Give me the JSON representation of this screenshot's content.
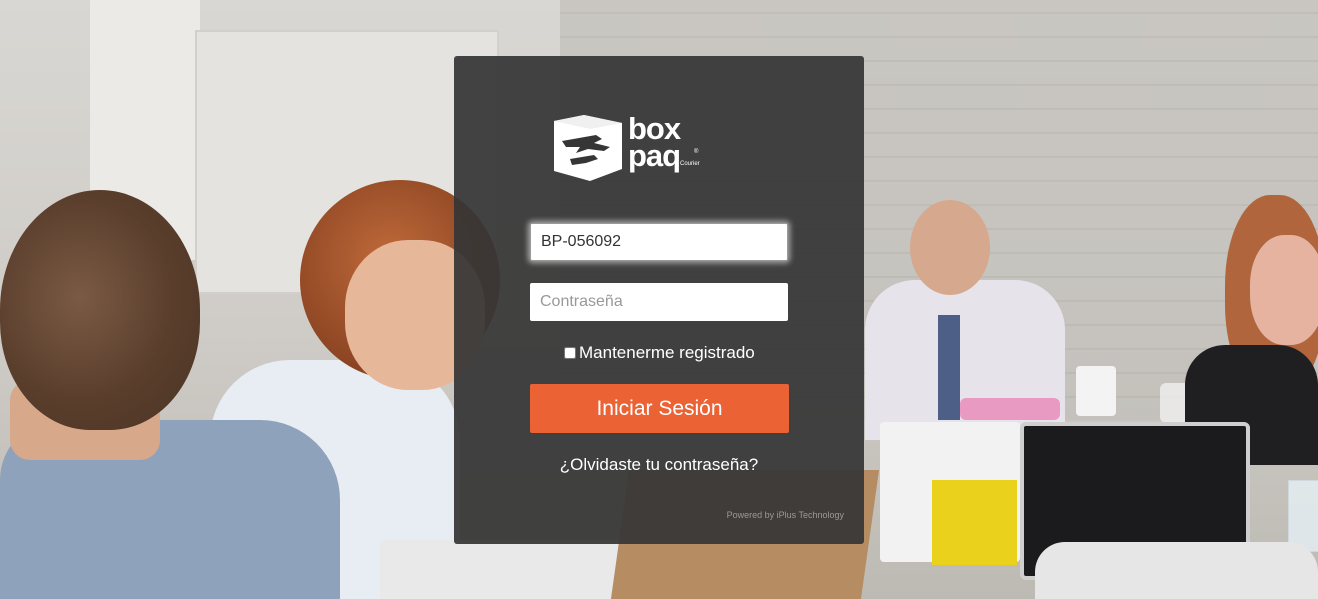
{
  "brand": {
    "line1": "box",
    "line2": "paq",
    "tagline": "Courier",
    "registered": "®"
  },
  "login": {
    "username_value": "BP-056092",
    "password_placeholder": "Contraseña",
    "remember_label": "Mantenerme registrado",
    "remember_checked": false,
    "submit_label": "Iniciar Sesión",
    "forgot_label": "¿Olvidaste tu contraseña?",
    "powered_by": "Powered by iPlus Technology"
  },
  "colors": {
    "panel_bg": "#363636",
    "button_bg": "#eb6234",
    "text": "#ffffff"
  }
}
